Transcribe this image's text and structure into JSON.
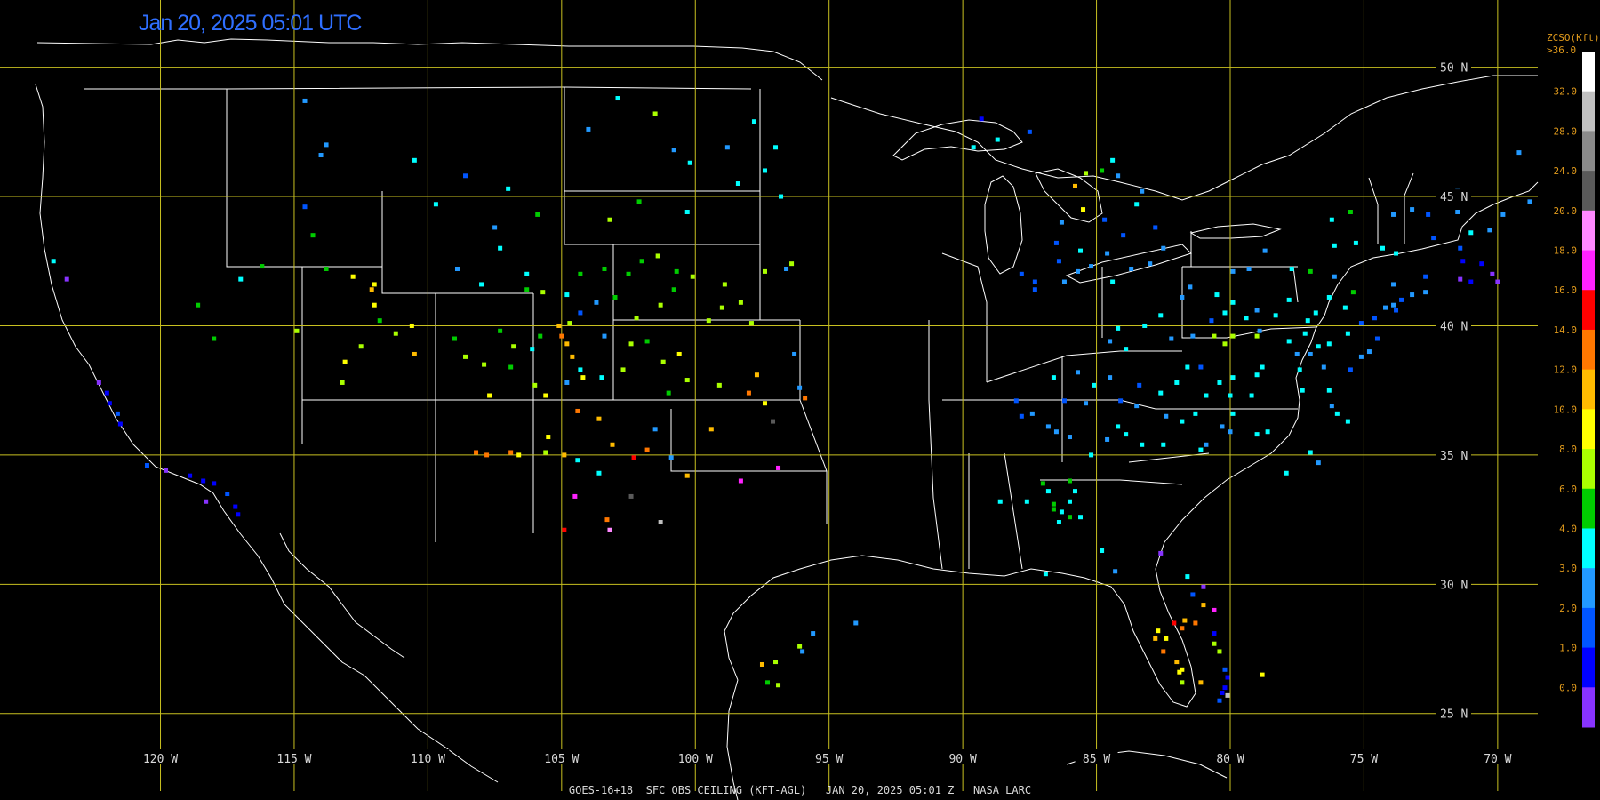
{
  "timestamp": "Jan 20, 2025 05:01 UTC",
  "footer": "GOES-16+18  SFC OBS CEILING (KFT-AGL)   JAN 20, 2025 05:01 Z   NASA LARC",
  "map": {
    "projection": "equirectangular",
    "lon_range": [
      -126,
      -68.5
    ],
    "lat_range": [
      22.0,
      52.6
    ],
    "lat_labels": [
      "50 N",
      "45 N",
      "40 N",
      "35 N",
      "30 N",
      "25 N"
    ],
    "lon_labels": [
      "120 W",
      "115 W",
      "110 W",
      "105 W",
      "100 W",
      "95 W",
      "90 W",
      "85 W",
      "80 W",
      "75 W",
      "70 W"
    ],
    "grid_color": "#c8c020",
    "border_color": "#ffffff"
  },
  "colorbar": {
    "title": "ZCSO(Kft)",
    "top_label": ">36.0",
    "labels": [
      "32.0",
      "28.0",
      "24.0",
      "20.0",
      "18.0",
      "16.0",
      "14.0",
      "12.0",
      "10.0",
      "8.0",
      "6.0",
      "4.0",
      "3.0",
      "2.0",
      "1.0",
      "0.0"
    ],
    "colors": [
      "#ffffff",
      "#c0c0c0",
      "#8a8a8a",
      "#5a5a5a",
      "#ff88ff",
      "#ff22ff",
      "#ff0000",
      "#ff7700",
      "#ffbb00",
      "#ffff00",
      "#aaff00",
      "#00cc00",
      "#00ffff",
      "#2299ff",
      "#0055ff",
      "#0000ff",
      "#8833ff"
    ]
  },
  "stations": [
    [
      -124.0,
      42.5,
      4
    ],
    [
      -123.5,
      41.8,
      0
    ],
    [
      -122.3,
      37.8,
      0
    ],
    [
      -122.0,
      37.4,
      1
    ],
    [
      -121.9,
      37.0,
      1
    ],
    [
      -121.6,
      36.6,
      2
    ],
    [
      -121.5,
      36.2,
      1
    ],
    [
      -120.5,
      34.6,
      2
    ],
    [
      -119.8,
      34.4,
      0
    ],
    [
      -118.9,
      34.2,
      1
    ],
    [
      -118.4,
      34.0,
      1
    ],
    [
      -118.0,
      33.9,
      1
    ],
    [
      -117.5,
      33.5,
      2
    ],
    [
      -117.2,
      33.0,
      1
    ],
    [
      -117.1,
      32.7,
      1
    ],
    [
      -118.3,
      33.2,
      0
    ],
    [
      -114.6,
      48.7,
      3
    ],
    [
      -113.8,
      47.0,
      3
    ],
    [
      -114.0,
      46.6,
      3
    ],
    [
      -114.3,
      43.5,
      5
    ],
    [
      -114.6,
      44.6,
      2
    ],
    [
      -116.2,
      42.3,
      5
    ],
    [
      -117.0,
      41.8,
      4
    ],
    [
      -118.6,
      40.8,
      5
    ],
    [
      -118.0,
      39.5,
      5
    ],
    [
      -114.9,
      39.8,
      6
    ],
    [
      -113.8,
      42.2,
      5
    ],
    [
      -112.8,
      41.9,
      7
    ],
    [
      -112.0,
      41.6,
      7
    ],
    [
      -112.1,
      41.4,
      8
    ],
    [
      -112.0,
      40.8,
      7
    ],
    [
      -111.8,
      40.2,
      5
    ],
    [
      -111.2,
      39.7,
      6
    ],
    [
      -110.6,
      40.0,
      7
    ],
    [
      -112.5,
      39.2,
      6
    ],
    [
      -113.1,
      38.6,
      7
    ],
    [
      -113.2,
      37.8,
      6
    ],
    [
      -110.5,
      38.9,
      8
    ],
    [
      -109.0,
      39.5,
      5
    ],
    [
      -109.7,
      44.7,
      4
    ],
    [
      -110.5,
      46.4,
      4
    ],
    [
      -108.6,
      45.8,
      2
    ],
    [
      -107.0,
      45.3,
      4
    ],
    [
      -107.5,
      43.8,
      3
    ],
    [
      -107.3,
      43.0,
      4
    ],
    [
      -105.9,
      44.3,
      5
    ],
    [
      -106.3,
      42.0,
      4
    ],
    [
      -108.0,
      41.6,
      4
    ],
    [
      -108.9,
      42.2,
      3
    ],
    [
      -106.3,
      41.4,
      5
    ],
    [
      -105.7,
      41.3,
      6
    ],
    [
      -104.8,
      41.2,
      4
    ],
    [
      -104.3,
      42.0,
      5
    ],
    [
      -103.4,
      42.2,
      5
    ],
    [
      -102.5,
      42.0,
      5
    ],
    [
      -102.0,
      42.5,
      5
    ],
    [
      -101.4,
      42.7,
      6
    ],
    [
      -100.7,
      42.1,
      5
    ],
    [
      -100.8,
      41.4,
      5
    ],
    [
      -101.3,
      40.8,
      6
    ],
    [
      -103.0,
      41.1,
      5
    ],
    [
      -103.7,
      40.9,
      3
    ],
    [
      -104.3,
      40.5,
      2
    ],
    [
      -104.7,
      40.1,
      6
    ],
    [
      -105.1,
      40.0,
      8
    ],
    [
      -105.0,
      39.6,
      9
    ],
    [
      -104.8,
      39.3,
      8
    ],
    [
      -105.8,
      39.6,
      5
    ],
    [
      -106.1,
      39.1,
      4
    ],
    [
      -106.8,
      39.2,
      6
    ],
    [
      -107.9,
      38.5,
      6
    ],
    [
      -106.9,
      38.4,
      5
    ],
    [
      -107.3,
      39.8,
      5
    ],
    [
      -108.6,
      38.8,
      6
    ],
    [
      -107.7,
      37.3,
      7
    ],
    [
      -106.0,
      37.7,
      6
    ],
    [
      -105.6,
      37.3,
      7
    ],
    [
      -104.8,
      37.8,
      3
    ],
    [
      -104.3,
      38.3,
      4
    ],
    [
      -103.5,
      38.0,
      4
    ],
    [
      -102.7,
      38.3,
      6
    ],
    [
      -101.8,
      39.4,
      5
    ],
    [
      -101.2,
      38.6,
      6
    ],
    [
      -100.6,
      38.9,
      7
    ],
    [
      -100.3,
      37.9,
      6
    ],
    [
      -101.0,
      37.4,
      5
    ],
    [
      -102.4,
      39.3,
      6
    ],
    [
      -103.4,
      39.6,
      3
    ],
    [
      -104.6,
      38.8,
      8
    ],
    [
      -104.2,
      38.0,
      7
    ],
    [
      -102.2,
      40.3,
      6
    ],
    [
      -99.5,
      40.2,
      6
    ],
    [
      -99.0,
      40.7,
      6
    ],
    [
      -98.3,
      40.9,
      6
    ],
    [
      -97.9,
      40.1,
      6
    ],
    [
      -100.1,
      41.9,
      6
    ],
    [
      -98.9,
      41.6,
      6
    ],
    [
      -97.4,
      42.1,
      6
    ],
    [
      -96.4,
      42.4,
      6
    ],
    [
      -103.2,
      44.1,
      6
    ],
    [
      -102.1,
      44.8,
      5
    ],
    [
      -100.3,
      44.4,
      4
    ],
    [
      -98.4,
      45.5,
      4
    ],
    [
      -97.4,
      46.0,
      4
    ],
    [
      -97.0,
      46.9,
      4
    ],
    [
      -97.8,
      47.9,
      4
    ],
    [
      -100.8,
      46.8,
      3
    ],
    [
      -101.5,
      48.2,
      6
    ],
    [
      -102.9,
      48.8,
      4
    ],
    [
      -104.0,
      47.6,
      3
    ],
    [
      -96.8,
      45.0,
      4
    ],
    [
      -100.2,
      46.3,
      4
    ],
    [
      -98.8,
      46.9,
      3
    ],
    [
      -99.1,
      37.7,
      6
    ],
    [
      -98.0,
      37.4,
      9
    ],
    [
      -97.4,
      37.0,
      7
    ],
    [
      -96.1,
      37.6,
      3
    ],
    [
      -97.7,
      38.1,
      8
    ],
    [
      -103.6,
      36.4,
      8
    ],
    [
      -104.4,
      36.7,
      9
    ],
    [
      -105.5,
      35.7,
      7
    ],
    [
      -106.6,
      35.0,
      7
    ],
    [
      -105.6,
      35.1,
      6
    ],
    [
      -106.9,
      35.1,
      9
    ],
    [
      -107.8,
      35.0,
      9
    ],
    [
      -108.2,
      35.1,
      9
    ],
    [
      -104.9,
      35.0,
      8
    ],
    [
      -103.1,
      35.4,
      8
    ],
    [
      -102.3,
      34.9,
      10
    ],
    [
      -104.4,
      34.8,
      4
    ],
    [
      -103.6,
      34.3,
      4
    ],
    [
      -104.5,
      33.4,
      11
    ],
    [
      -104.9,
      32.1,
      10
    ],
    [
      -103.2,
      32.1,
      12
    ],
    [
      -103.3,
      32.5,
      9
    ],
    [
      -102.4,
      33.4,
      13
    ],
    [
      -101.8,
      35.2,
      9
    ],
    [
      -101.5,
      36.0,
      3
    ],
    [
      -100.9,
      34.9,
      3
    ],
    [
      -100.3,
      34.2,
      8
    ],
    [
      -99.4,
      36.0,
      8
    ],
    [
      -98.3,
      34.0,
      11
    ],
    [
      -97.1,
      36.3,
      13
    ],
    [
      -96.9,
      34.5,
      11
    ],
    [
      -95.6,
      28.1,
      3
    ],
    [
      -94.0,
      28.5,
      3
    ],
    [
      -96.1,
      27.6,
      6
    ],
    [
      -96.0,
      27.4,
      3
    ],
    [
      -97.5,
      26.9,
      8
    ],
    [
      -97.0,
      27.0,
      6
    ],
    [
      -97.3,
      26.2,
      5
    ],
    [
      -96.9,
      26.1,
      6
    ],
    [
      -101.3,
      32.4,
      15
    ],
    [
      -96.3,
      38.9,
      3
    ],
    [
      -96.6,
      42.2,
      3
    ],
    [
      -95.9,
      37.2,
      9
    ],
    [
      -89.6,
      46.9,
      4
    ],
    [
      -88.7,
      47.2,
      4
    ],
    [
      -89.3,
      48.0,
      1
    ],
    [
      -87.5,
      47.5,
      2
    ],
    [
      -85.8,
      45.4,
      8
    ],
    [
      -85.5,
      44.5,
      7
    ],
    [
      -84.4,
      46.4,
      4
    ],
    [
      -84.8,
      46.0,
      5
    ],
    [
      -85.4,
      45.9,
      6
    ],
    [
      -84.2,
      45.8,
      3
    ],
    [
      -86.3,
      44.0,
      3
    ],
    [
      -86.5,
      43.2,
      2
    ],
    [
      -86.4,
      42.5,
      2
    ],
    [
      -85.6,
      42.9,
      4
    ],
    [
      -85.7,
      42.1,
      3
    ],
    [
      -87.8,
      42.0,
      2
    ],
    [
      -87.3,
      41.7,
      2
    ],
    [
      -87.3,
      41.4,
      2
    ],
    [
      -86.2,
      41.7,
      3
    ],
    [
      -85.2,
      42.3,
      3
    ],
    [
      -84.4,
      41.7,
      4
    ],
    [
      -83.7,
      42.2,
      3
    ],
    [
      -83.0,
      42.4,
      3
    ],
    [
      -82.5,
      43.0,
      3
    ],
    [
      -84.6,
      42.8,
      3
    ],
    [
      -84.0,
      43.5,
      2
    ],
    [
      -84.7,
      44.1,
      2
    ],
    [
      -83.5,
      44.7,
      4
    ],
    [
      -83.3,
      45.2,
      3
    ],
    [
      -82.8,
      43.8,
      2
    ],
    [
      -81.5,
      41.5,
      3
    ],
    [
      -81.8,
      41.1,
      3
    ],
    [
      -82.6,
      40.4,
      4
    ],
    [
      -83.2,
      40.0,
      4
    ],
    [
      -84.2,
      39.9,
      4
    ],
    [
      -84.5,
      39.4,
      3
    ],
    [
      -83.9,
      39.1,
      4
    ],
    [
      -82.2,
      39.5,
      3
    ],
    [
      -81.4,
      39.6,
      3
    ],
    [
      -80.7,
      40.2,
      2
    ],
    [
      -80.2,
      40.5,
      4
    ],
    [
      -79.9,
      40.9,
      4
    ],
    [
      -79.4,
      40.3,
      4
    ],
    [
      -79.0,
      40.6,
      3
    ],
    [
      -78.3,
      40.4,
      4
    ],
    [
      -77.8,
      41.0,
      4
    ],
    [
      -77.1,
      40.2,
      4
    ],
    [
      -76.8,
      40.5,
      4
    ],
    [
      -76.3,
      41.1,
      4
    ],
    [
      -75.7,
      40.7,
      4
    ],
    [
      -75.4,
      41.3,
      5
    ],
    [
      -76.1,
      41.9,
      3
    ],
    [
      -77.0,
      42.1,
      5
    ],
    [
      -77.7,
      42.2,
      4
    ],
    [
      -78.7,
      42.9,
      3
    ],
    [
      -79.3,
      42.2,
      3
    ],
    [
      -79.9,
      42.1,
      3
    ],
    [
      -80.5,
      41.2,
      4
    ],
    [
      -76.1,
      43.1,
      4
    ],
    [
      -75.3,
      43.2,
      4
    ],
    [
      -74.3,
      43.0,
      4
    ],
    [
      -73.8,
      42.8,
      4
    ],
    [
      -73.9,
      44.3,
      3
    ],
    [
      -75.5,
      44.4,
      5
    ],
    [
      -76.2,
      44.1,
      4
    ],
    [
      -73.2,
      44.5,
      3
    ],
    [
      -72.6,
      44.3,
      2
    ],
    [
      -71.5,
      44.4,
      3
    ],
    [
      -71.0,
      43.6,
      4
    ],
    [
      -70.3,
      43.7,
      3
    ],
    [
      -69.8,
      44.3,
      3
    ],
    [
      -68.8,
      44.8,
      3
    ],
    [
      -69.2,
      46.7,
      3
    ],
    [
      -71.5,
      45.2,
      3
    ],
    [
      -72.4,
      43.4,
      2
    ],
    [
      -71.4,
      43.0,
      2
    ],
    [
      -71.3,
      42.5,
      1
    ],
    [
      -70.6,
      42.4,
      1
    ],
    [
      -71.0,
      41.7,
      1
    ],
    [
      -71.4,
      41.8,
      0
    ],
    [
      -70.0,
      41.7,
      0
    ],
    [
      -70.2,
      42.0,
      0
    ],
    [
      -72.7,
      41.9,
      2
    ],
    [
      -72.7,
      41.3,
      3
    ],
    [
      -73.2,
      41.2,
      3
    ],
    [
      -73.6,
      41.0,
      2
    ],
    [
      -73.9,
      41.6,
      3
    ],
    [
      -73.9,
      40.8,
      3
    ],
    [
      -73.8,
      40.6,
      2
    ],
    [
      -74.2,
      40.7,
      3
    ],
    [
      -74.6,
      40.3,
      2
    ],
    [
      -74.5,
      39.5,
      2
    ],
    [
      -74.8,
      39.0,
      3
    ],
    [
      -75.1,
      40.1,
      2
    ],
    [
      -75.6,
      39.7,
      4
    ],
    [
      -76.3,
      39.3,
      4
    ],
    [
      -76.7,
      39.2,
      4
    ],
    [
      -77.0,
      38.9,
      3
    ],
    [
      -77.5,
      38.9,
      3
    ],
    [
      -77.4,
      38.3,
      4
    ],
    [
      -76.5,
      38.4,
      3
    ],
    [
      -75.5,
      38.3,
      2
    ],
    [
      -75.1,
      38.8,
      3
    ],
    [
      -76.3,
      37.5,
      4
    ],
    [
      -77.3,
      37.5,
      4
    ],
    [
      -76.2,
      36.9,
      3
    ],
    [
      -76.0,
      36.6,
      4
    ],
    [
      -75.6,
      36.3,
      4
    ],
    [
      -78.8,
      38.4,
      4
    ],
    [
      -79.0,
      38.1,
      4
    ],
    [
      -79.9,
      38.0,
      4
    ],
    [
      -80.4,
      37.8,
      4
    ],
    [
      -80.9,
      37.3,
      4
    ],
    [
      -81.1,
      38.4,
      2
    ],
    [
      -81.6,
      38.4,
      4
    ],
    [
      -82.0,
      37.8,
      4
    ],
    [
      -82.6,
      37.4,
      4
    ],
    [
      -83.4,
      37.7,
      2
    ],
    [
      -84.5,
      38.0,
      3
    ],
    [
      -85.7,
      38.2,
      3
    ],
    [
      -86.2,
      37.1,
      2
    ],
    [
      -85.4,
      37.0,
      3
    ],
    [
      -84.1,
      37.1,
      2
    ],
    [
      -83.5,
      36.9,
      3
    ],
    [
      -82.4,
      36.5,
      3
    ],
    [
      -81.8,
      36.3,
      4
    ],
    [
      -81.3,
      36.6,
      4
    ],
    [
      -80.3,
      36.1,
      3
    ],
    [
      -79.9,
      36.6,
      4
    ],
    [
      -79.2,
      37.3,
      4
    ],
    [
      -80.0,
      37.3,
      4
    ],
    [
      -80.6,
      39.6,
      6
    ],
    [
      -79.9,
      39.6,
      6
    ],
    [
      -80.2,
      39.3,
      6
    ],
    [
      -79.0,
      39.6,
      6
    ],
    [
      -78.9,
      39.8,
      3
    ],
    [
      -77.8,
      39.4,
      4
    ],
    [
      -77.2,
      39.7,
      4
    ],
    [
      -84.2,
      36.1,
      4
    ],
    [
      -85.2,
      35.0,
      4
    ],
    [
      -84.6,
      35.6,
      3
    ],
    [
      -83.9,
      35.8,
      4
    ],
    [
      -83.3,
      35.4,
      4
    ],
    [
      -82.5,
      35.4,
      4
    ],
    [
      -81.1,
      35.2,
      4
    ],
    [
      -80.9,
      35.4,
      3
    ],
    [
      -80.0,
      35.9,
      3
    ],
    [
      -79.0,
      35.8,
      4
    ],
    [
      -78.6,
      35.9,
      4
    ],
    [
      -77.9,
      34.3,
      4
    ],
    [
      -77.0,
      35.1,
      4
    ],
    [
      -76.7,
      34.7,
      3
    ],
    [
      -86.8,
      36.1,
      3
    ],
    [
      -87.4,
      36.6,
      3
    ],
    [
      -88.0,
      37.1,
      2
    ],
    [
      -86.5,
      35.9,
      3
    ],
    [
      -87.8,
      36.5,
      2
    ],
    [
      -86.0,
      35.7,
      3
    ],
    [
      -85.1,
      37.7,
      4
    ],
    [
      -86.6,
      38.0,
      4
    ],
    [
      -86.8,
      33.6,
      4
    ],
    [
      -86.6,
      33.1,
      5
    ],
    [
      -86.4,
      32.4,
      4
    ],
    [
      -86.6,
      32.9,
      5
    ],
    [
      -87.0,
      33.9,
      5
    ],
    [
      -86.0,
      34.0,
      5
    ],
    [
      -85.8,
      33.6,
      4
    ],
    [
      -86.0,
      32.6,
      5
    ],
    [
      -85.6,
      32.6,
      4
    ],
    [
      -86.3,
      32.8,
      4
    ],
    [
      -87.6,
      33.2,
      4
    ],
    [
      -88.6,
      33.2,
      4
    ],
    [
      -86.0,
      33.2,
      4
    ],
    [
      -84.8,
      31.3,
      4
    ],
    [
      -82.6,
      31.2,
      0
    ],
    [
      -84.3,
      30.5,
      3
    ],
    [
      -86.9,
      30.4,
      4
    ],
    [
      -82.4,
      27.9,
      7
    ],
    [
      -82.5,
      27.4,
      9
    ],
    [
      -82.8,
      27.9,
      8
    ],
    [
      -82.7,
      28.2,
      7
    ],
    [
      -82.1,
      28.5,
      10
    ],
    [
      -81.7,
      28.6,
      8
    ],
    [
      -81.8,
      28.3,
      9
    ],
    [
      -81.3,
      28.5,
      9
    ],
    [
      -81.0,
      29.2,
      8
    ],
    [
      -81.4,
      29.6,
      2
    ],
    [
      -80.6,
      28.1,
      1
    ],
    [
      -80.6,
      27.7,
      6
    ],
    [
      -80.4,
      27.4,
      6
    ],
    [
      -80.2,
      26.7,
      2
    ],
    [
      -80.1,
      26.4,
      1
    ],
    [
      -80.2,
      26.0,
      1
    ],
    [
      -80.3,
      25.8,
      1
    ],
    [
      -80.4,
      25.5,
      2
    ],
    [
      -81.8,
      26.2,
      6
    ],
    [
      -81.9,
      26.6,
      7
    ],
    [
      -82.0,
      27.0,
      8
    ],
    [
      -81.8,
      26.7,
      7
    ],
    [
      -81.1,
      26.2,
      8
    ],
    [
      -80.1,
      25.7,
      15
    ],
    [
      -81.6,
      30.3,
      4
    ],
    [
      -81.0,
      29.9,
      0
    ],
    [
      -78.8,
      26.5,
      7
    ],
    [
      -80.6,
      29.0,
      11
    ]
  ]
}
